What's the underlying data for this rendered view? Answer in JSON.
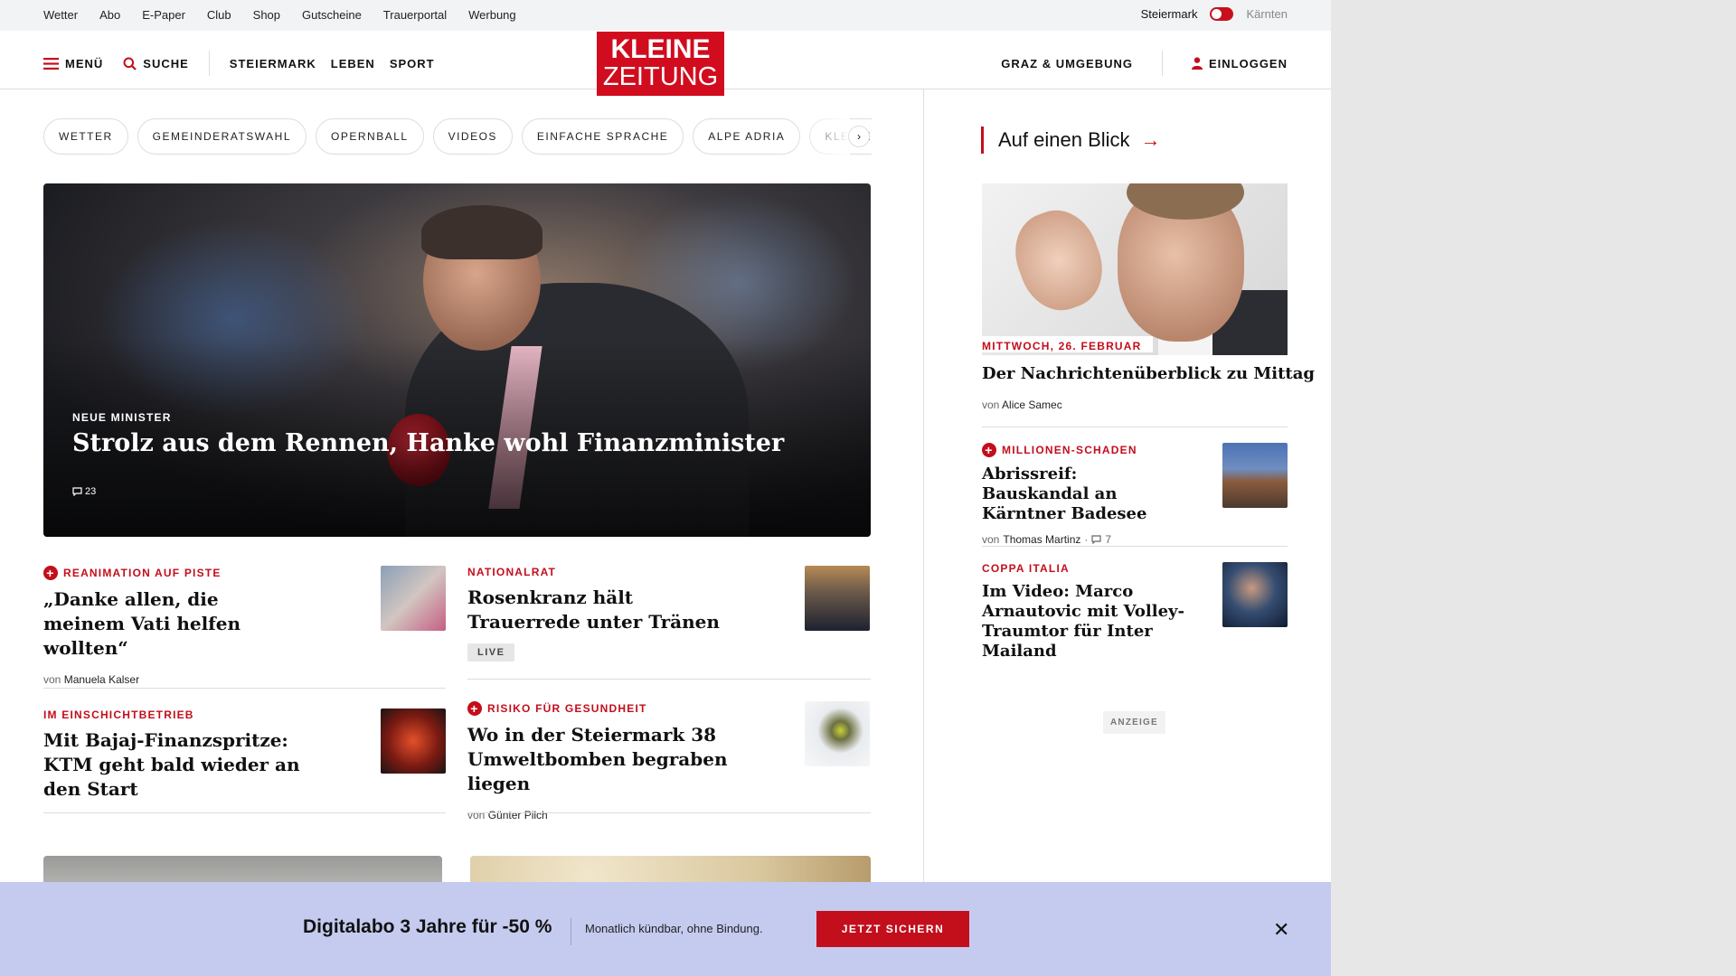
{
  "utility_bar": {
    "links": [
      "Wetter",
      "Abo",
      "E-Paper",
      "Club",
      "Shop",
      "Gutscheine",
      "Trauerportal",
      "Werbung"
    ],
    "region_active": "Steiermark",
    "region_inactive": "Kärnten"
  },
  "header": {
    "menu_label": "MENÜ",
    "search_label": "SUCHE",
    "nav": [
      "STEIERMARK",
      "LEBEN",
      "SPORT"
    ],
    "logo_line1": "KLEINE",
    "logo_line2": "ZEITUNG",
    "region_link": "GRAZ & UMGEBUNG",
    "login_label": "EINLOGGEN"
  },
  "topics": [
    "WETTER",
    "GEMEINDERATSWAHL",
    "OPERNBALL",
    "VIDEOS",
    "EINFACHE SPRACHE",
    "ALPE ADRIA",
    "KLEINE"
  ],
  "hero": {
    "kicker": "NEUE MINISTER",
    "title": "Strolz aus dem Rennen, Hanke wohl Finanzminister",
    "comments": "23"
  },
  "teasers": [
    {
      "kicker": "REANIMATION AUF PISTE",
      "premium": true,
      "title": "„Danke allen, die meinem Vati helfen wollten“",
      "byline_prefix": "von",
      "author": "Manuela Kalser"
    },
    {
      "kicker": "NATIONALRAT",
      "premium": false,
      "title": "Rosenkranz hält Trauerrede unter Tränen",
      "badge": "LIVE"
    },
    {
      "kicker": "IM EINSCHICHTBETRIEB",
      "premium": false,
      "title": "Mit Bajaj-Finanzspritze: KTM geht bald wieder an den Start"
    },
    {
      "kicker": "RISIKO FÜR GESUNDHEIT",
      "premium": true,
      "title": "Wo in der Steiermark 38 Umweltbomben begraben liegen",
      "byline_prefix": "von",
      "author": "Günter Pilch"
    }
  ],
  "sidebar": {
    "title": "Auf einen Blick",
    "lead": {
      "date": "MITTWOCH, 26. FEBRUAR",
      "title": "Der Nachrichtenüberblick zu Mittag",
      "byline_prefix": "von",
      "author": "Alice Samec"
    },
    "items": [
      {
        "kicker": "MILLIONEN-SCHADEN",
        "premium": true,
        "title": "Abrissreif: Bauskandal an Kärntner Badesee",
        "byline_prefix": "von",
        "author": "Thomas Martinz",
        "comments": "7"
      },
      {
        "kicker": "COPPA ITALIA",
        "premium": false,
        "title": "Im Video: Marco Arnautovic mit Volley-Traumtor für Inter Mailand"
      }
    ],
    "ad_label": "ANZEIGE"
  },
  "promo": {
    "headline": "Digitalabo 3 Jahre für -50 %",
    "subline": "Monatlich kündbar, ohne Bindung.",
    "cta": "JETZT SICHERN"
  },
  "colors": {
    "brand_red": "#c30e1c",
    "promo_bg": "#c5cbef"
  }
}
